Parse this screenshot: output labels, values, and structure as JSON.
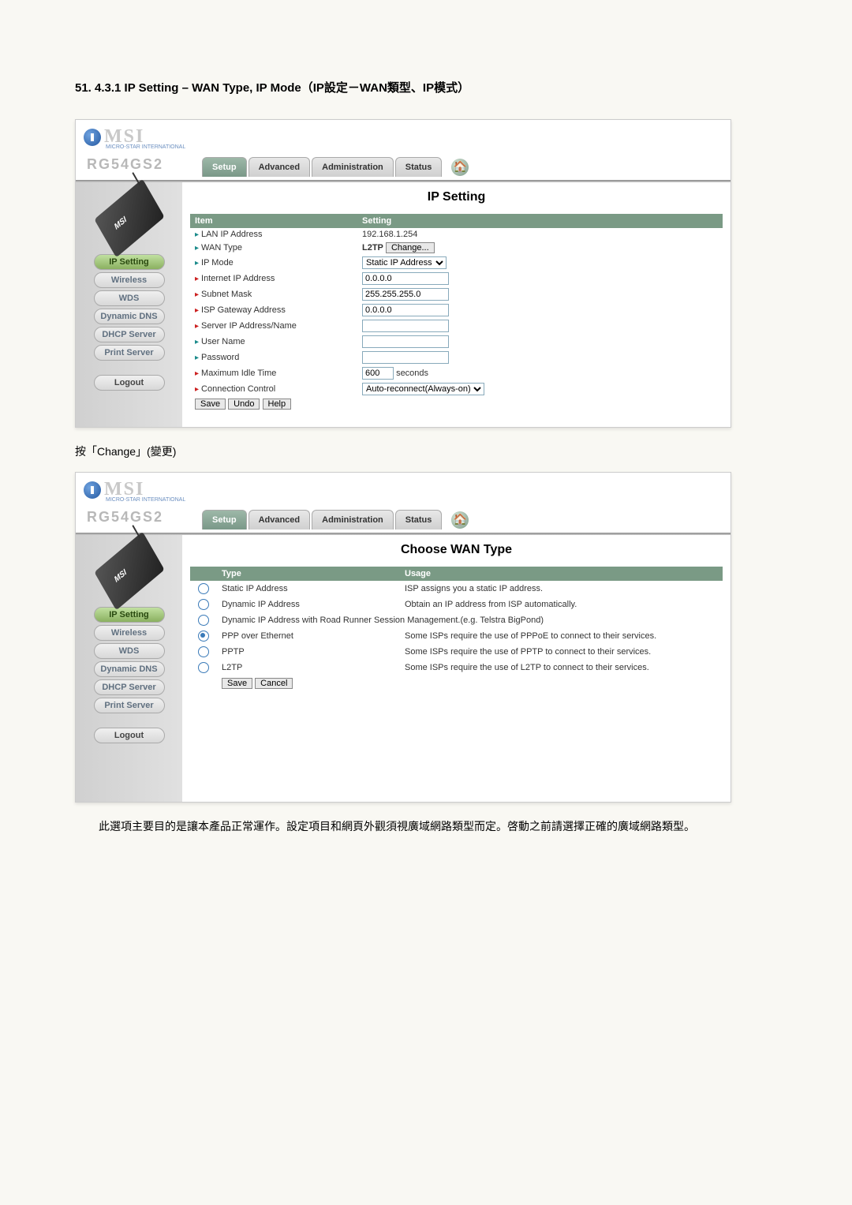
{
  "doc": {
    "heading": "51.   4.3.1 IP Setting – WAN Type, IP Mode（IP設定－WAN類型、IP模式）",
    "change_line": "按「Change」(變更)",
    "footer_text": "此選項主要目的是讓本產品正常運作。設定項目和網頁外觀須視廣域網路類型而定。啓動之前請選擇正確的廣域網路類型。"
  },
  "logo": {
    "brand": "MSI",
    "subtitle": "MICRO-STAR INTERNATIONAL",
    "model": "RG54GS2",
    "router_label": "MSI"
  },
  "tabs": {
    "setup": "Setup",
    "advanced": "Advanced",
    "administration": "Administration",
    "status": "Status"
  },
  "sidebar": {
    "ip_setting": "IP Setting",
    "wireless": "Wireless",
    "wds": "WDS",
    "dynamic_dns": "Dynamic DNS",
    "dhcp_server": "DHCP Server",
    "print_server": "Print Server",
    "logout": "Logout"
  },
  "panel1": {
    "title": "IP Setting",
    "col_item": "Item",
    "col_setting": "Setting",
    "rows": {
      "lan_ip": "LAN IP Address",
      "wan_type": "WAN Type",
      "ip_mode": "IP Mode",
      "internet_ip": "Internet IP Address",
      "subnet": "Subnet Mask",
      "isp_gw": "ISP Gateway Address",
      "server_ip": "Server IP Address/Name",
      "user_name": "User Name",
      "password": "Password",
      "max_idle": "Maximum Idle Time",
      "conn_ctrl": "Connection Control"
    },
    "values": {
      "lan_ip": "192.168.1.254",
      "wan_type_label": "L2TP",
      "change_btn": "Change...",
      "ip_mode_sel": "Static IP Address",
      "internet_ip": "0.0.0.0",
      "subnet": "255.255.255.0",
      "isp_gw": "0.0.0.0",
      "server_ip": "",
      "user_name": "",
      "password": "",
      "max_idle": "600",
      "seconds": "seconds",
      "conn_ctrl_sel": "Auto-reconnect(Always-on)"
    },
    "buttons": {
      "save": "Save",
      "undo": "Undo",
      "help": "Help"
    }
  },
  "panel2": {
    "title": "Choose WAN Type",
    "col_type": "Type",
    "col_usage": "Usage",
    "options": [
      {
        "type": "Static IP Address",
        "usage": "ISP assigns you a static IP address.",
        "selected": false
      },
      {
        "type": "Dynamic IP Address",
        "usage": "Obtain an IP address from ISP automatically.",
        "selected": false
      },
      {
        "type": "Dynamic IP Address with Road Runner Session Management.(e.g. Telstra BigPond)",
        "usage": "",
        "selected": false
      },
      {
        "type": "PPP over Ethernet",
        "usage": "Some ISPs require the use of PPPoE to connect to their services.",
        "selected": true
      },
      {
        "type": "PPTP",
        "usage": "Some ISPs require the use of PPTP to connect to their services.",
        "selected": false
      },
      {
        "type": "L2TP",
        "usage": "Some ISPs require the use of L2TP to connect to their services.",
        "selected": false
      }
    ],
    "buttons": {
      "save": "Save",
      "cancel": "Cancel"
    }
  }
}
